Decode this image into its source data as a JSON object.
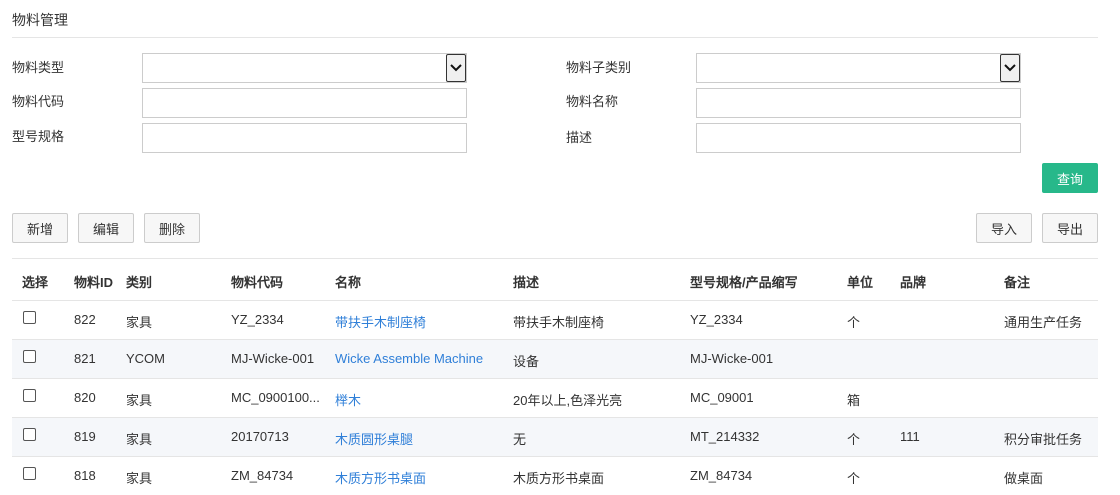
{
  "page": {
    "title": "物料管理"
  },
  "filters": {
    "material_type_label": "物料类型",
    "material_subcategory_label": "物料子类别",
    "material_code_label": "物料代码",
    "material_name_label": "物料名称",
    "model_spec_label": "型号规格",
    "description_label": "描述",
    "query_button": "查询"
  },
  "toolbar": {
    "add": "新增",
    "edit": "编辑",
    "delete": "删除",
    "import": "导入",
    "export": "导出"
  },
  "table": {
    "headers": {
      "select": "选择",
      "id": "物料ID",
      "category": "类别",
      "code": "物料代码",
      "name": "名称",
      "description": "描述",
      "model": "型号规格/产品缩写",
      "unit": "单位",
      "brand": "品牌",
      "remark": "备注"
    },
    "rows": [
      {
        "id": "822",
        "category": "家具",
        "code": "YZ_2334",
        "name": "带扶手木制座椅",
        "description": "带扶手木制座椅",
        "model": "YZ_2334",
        "unit": "个",
        "brand": "",
        "remark": "通用生产任务"
      },
      {
        "id": "821",
        "category": "YCOM",
        "code": "MJ-Wicke-001",
        "name": "Wicke Assemble Machine",
        "description": "设备",
        "model": "MJ-Wicke-001",
        "unit": "",
        "brand": "",
        "remark": ""
      },
      {
        "id": "820",
        "category": "家具",
        "code": "MC_0900100...",
        "name": "榉木",
        "description": "20年以上,色泽光亮",
        "model": "MC_09001",
        "unit": "箱",
        "brand": "",
        "remark": ""
      },
      {
        "id": "819",
        "category": "家具",
        "code": "20170713",
        "name": "木质圆形桌腿",
        "description": "无",
        "model": "MT_214332",
        "unit": "个",
        "brand": "111",
        "remark": "积分审批任务"
      },
      {
        "id": "818",
        "category": "家具",
        "code": "ZM_84734",
        "name": "木质方形书桌面",
        "description": "木质方形书桌面",
        "model": "ZM_84734",
        "unit": "个",
        "brand": "",
        "remark": "做桌面"
      }
    ]
  }
}
